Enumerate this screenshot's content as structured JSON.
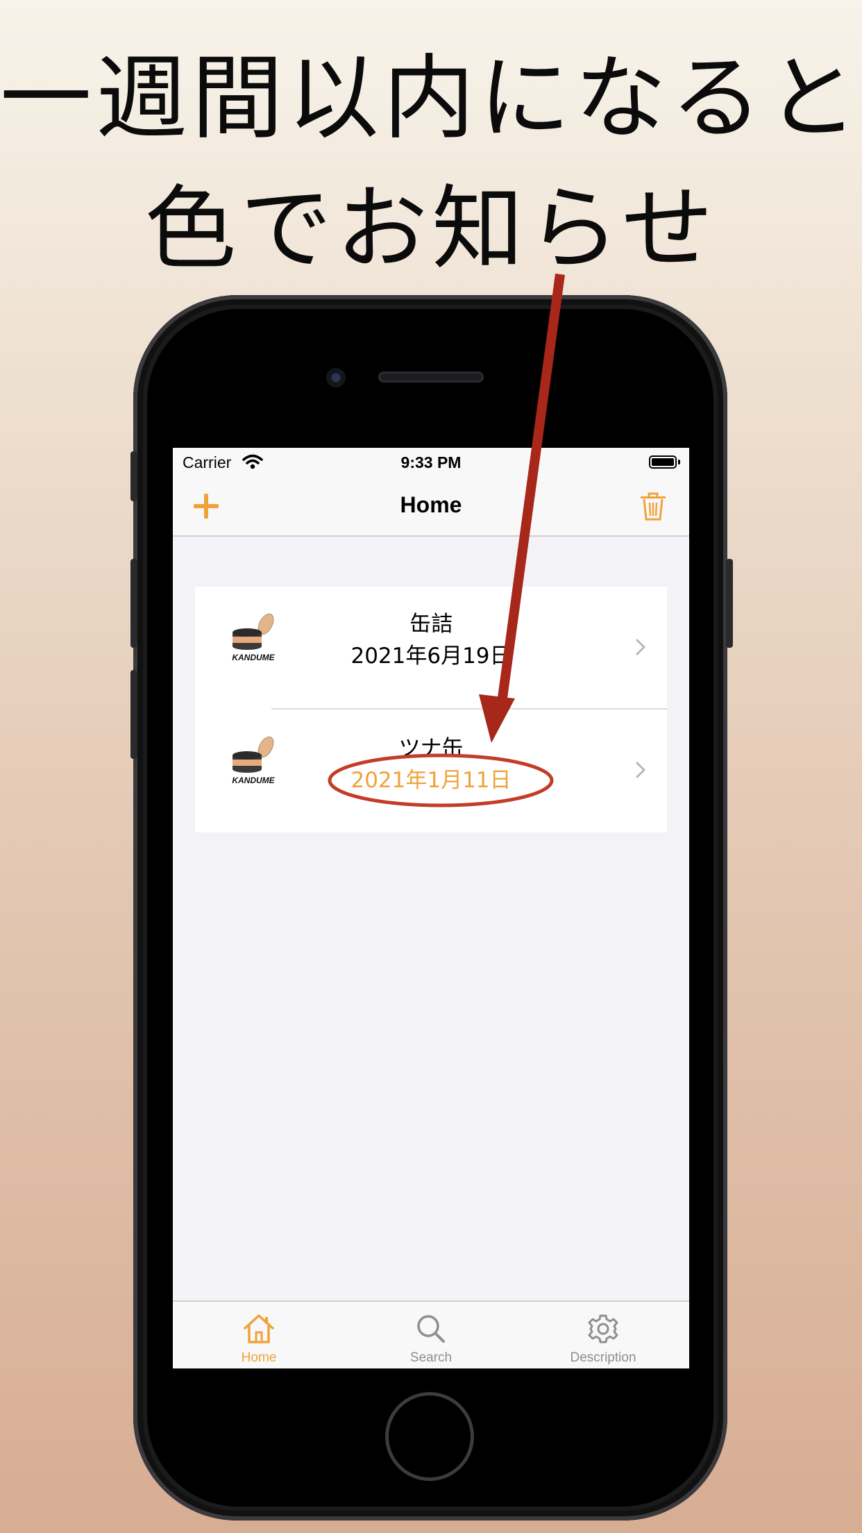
{
  "headline": {
    "line1": "一週間以内になると",
    "line2": "色でお知らせ"
  },
  "status_bar": {
    "carrier": "Carrier",
    "time": "9:33 PM"
  },
  "nav": {
    "title": "Home",
    "add_icon": "plus-icon",
    "trash_icon": "trash-icon"
  },
  "items": [
    {
      "title": "缶詰",
      "date": "2021年6月19日",
      "logo_text": "KANDUME",
      "highlight": false
    },
    {
      "title": "ツナ缶",
      "date": "2021年1月11日",
      "logo_text": "KANDUME",
      "highlight": true
    }
  ],
  "tabs": [
    {
      "label": "Home",
      "icon": "house-icon",
      "active": true
    },
    {
      "label": "Search",
      "icon": "magnifier-icon",
      "active": false
    },
    {
      "label": "Description",
      "icon": "gear-icon",
      "active": false
    }
  ],
  "colors": {
    "accent": "#f0a23a",
    "annotation": "#a8271b",
    "inactive_tab": "#8e8e93"
  }
}
